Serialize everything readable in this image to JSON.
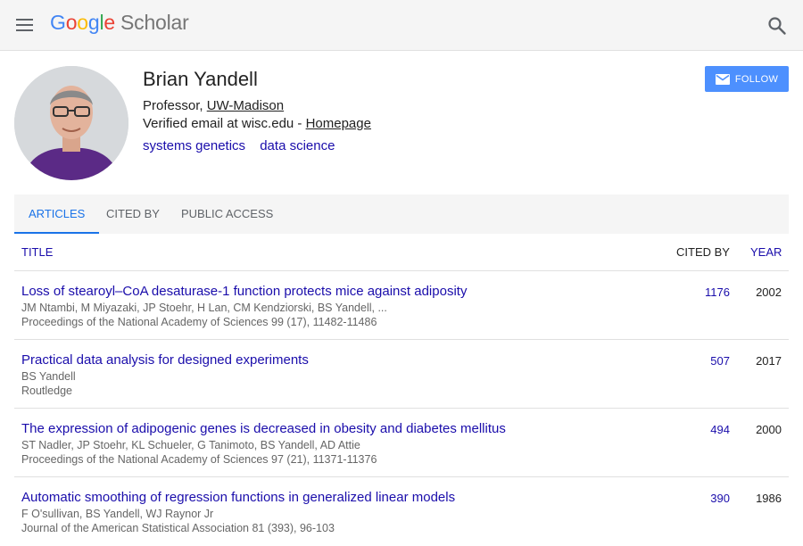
{
  "header": {
    "logo": {
      "G": "G",
      "o1": "o",
      "o2": "o",
      "g": "g",
      "l": "l",
      "e": "e",
      "scholar": "Scholar"
    },
    "menu_icon": "hamburger-menu-icon",
    "search_icon": "search-icon"
  },
  "profile": {
    "name": "Brian Yandell",
    "affiliation_prefix": "Professor, ",
    "affiliation_link": "UW-Madison",
    "email_text": "Verified email at wisc.edu - ",
    "homepage_link": "Homepage",
    "interests": [
      "systems genetics",
      "data science"
    ],
    "follow_label": "FOLLOW",
    "follow_icon": "mail-icon",
    "follow_color": "#4d90fe"
  },
  "tabs": [
    {
      "label": "ARTICLES",
      "active": true
    },
    {
      "label": "CITED BY",
      "active": false
    },
    {
      "label": "PUBLIC ACCESS",
      "active": false
    }
  ],
  "table": {
    "headers": {
      "title": "TITLE",
      "cited_by": "CITED BY",
      "year": "YEAR"
    },
    "rows": [
      {
        "title": "Loss of stearoyl–CoA desaturase-1 function protects mice against adiposity",
        "authors": "JM Ntambi, M Miyazaki, JP Stoehr, H Lan, CM Kendziorski, BS Yandell, ...",
        "venue": "Proceedings of the National Academy of Sciences 99 (17), 11482-11486",
        "cited_by": "1176",
        "year": "2002"
      },
      {
        "title": "Practical data analysis for designed experiments",
        "authors": "BS Yandell",
        "venue": "Routledge",
        "cited_by": "507",
        "year": "2017"
      },
      {
        "title": "The expression of adipogenic genes is decreased in obesity and diabetes mellitus",
        "authors": "ST Nadler, JP Stoehr, KL Schueler, G Tanimoto, BS Yandell, AD Attie",
        "venue": "Proceedings of the National Academy of Sciences 97 (21), 11371-11376",
        "cited_by": "494",
        "year": "2000"
      },
      {
        "title": "Automatic smoothing of regression functions in generalized linear models",
        "authors": "F O'sullivan, BS Yandell, WJ Raynor Jr",
        "venue": "Journal of the American Statistical Association 81 (393), 96-103",
        "cited_by": "390",
        "year": "1986"
      }
    ]
  },
  "colors": {
    "link": "#1a0dab",
    "accent": "#1a73e8",
    "topbar_bg": "#f5f5f5"
  }
}
